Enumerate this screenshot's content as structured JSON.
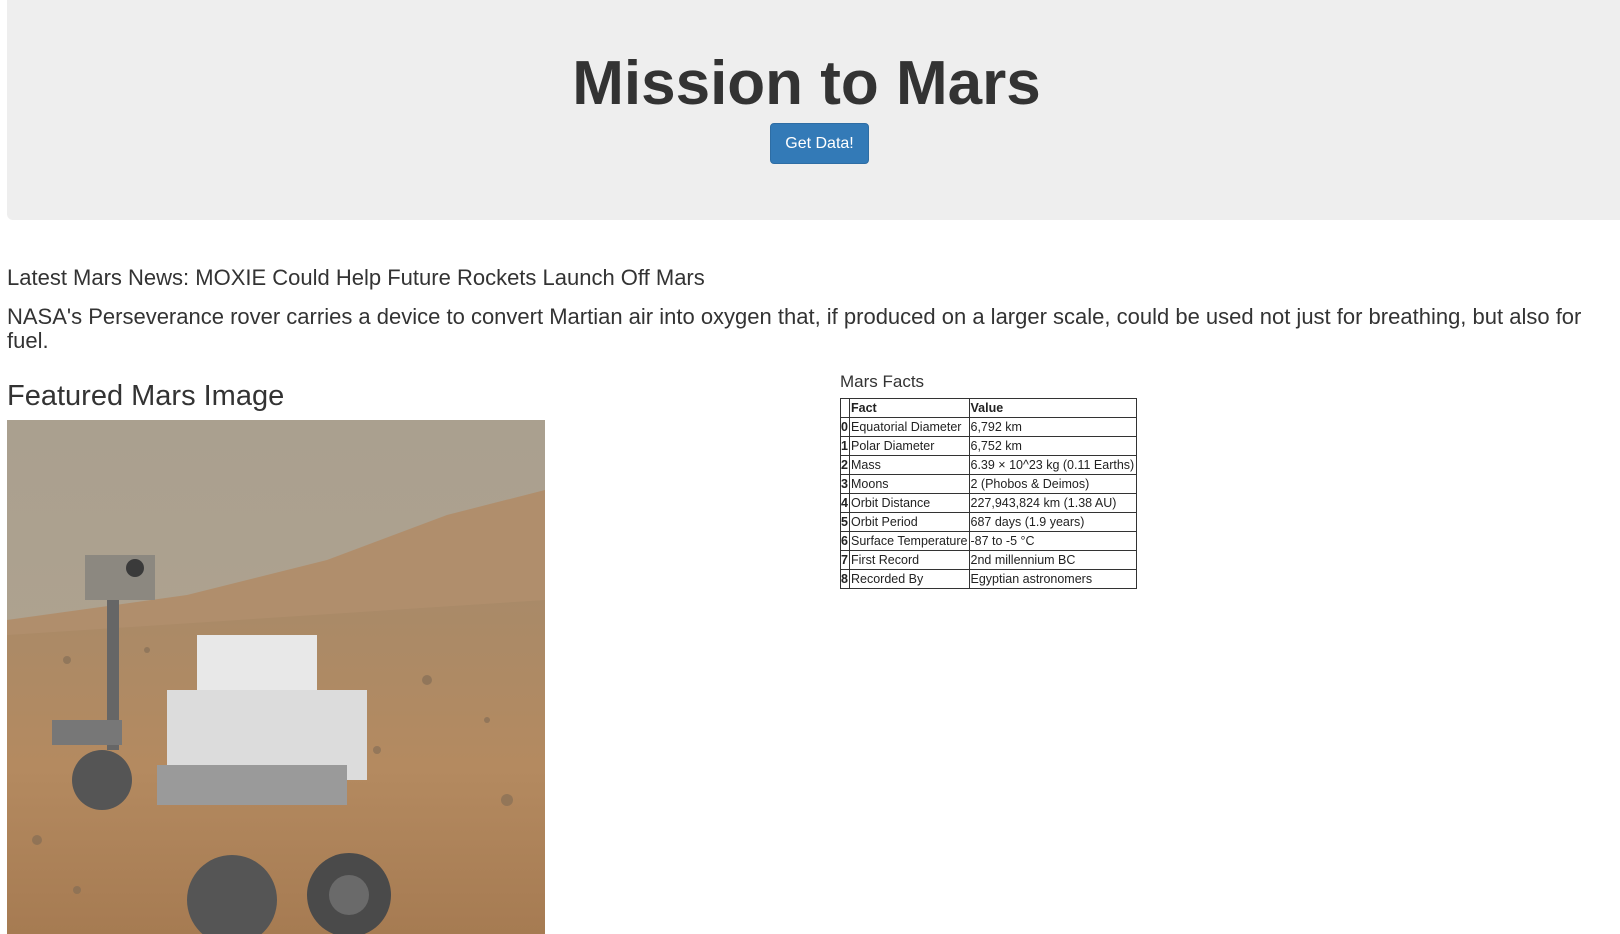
{
  "header": {
    "title": "Mission to Mars",
    "button_label": "Get Data!"
  },
  "news": {
    "heading_prefix": "Latest Mars News: ",
    "headline": "MOXIE Could Help Future Rockets Launch Off Mars",
    "paragraph": "NASA's Perseverance rover carries a device to convert Martian air into oxygen that, if produced on a larger scale, could be used not just for breathing, but also for fuel."
  },
  "featured": {
    "heading": "Featured Mars Image",
    "image_subject": "Curiosity rover selfie on Martian surface"
  },
  "facts": {
    "heading": "Mars Facts",
    "columns": [
      "",
      "Fact",
      "Value"
    ],
    "rows": [
      {
        "index": "0",
        "fact": "Equatorial Diameter",
        "value": "6,792 km"
      },
      {
        "index": "1",
        "fact": "Polar Diameter",
        "value": "6,752 km"
      },
      {
        "index": "2",
        "fact": "Mass",
        "value": "6.39 × 10^23 kg (0.11 Earths)"
      },
      {
        "index": "3",
        "fact": "Moons",
        "value": "2 (Phobos & Deimos)"
      },
      {
        "index": "4",
        "fact": "Orbit Distance",
        "value": "227,943,824 km (1.38 AU)"
      },
      {
        "index": "5",
        "fact": "Orbit Period",
        "value": "687 days (1.9 years)"
      },
      {
        "index": "6",
        "fact": "Surface Temperature",
        "value": "-87 to -5 °C"
      },
      {
        "index": "7",
        "fact": "First Record",
        "value": "2nd millennium BC"
      },
      {
        "index": "8",
        "fact": "Recorded By",
        "value": "Egyptian astronomers"
      }
    ]
  },
  "colors": {
    "button_bg": "#337ab7",
    "jumbotron_bg": "#eeeeee",
    "text": "#333333"
  }
}
